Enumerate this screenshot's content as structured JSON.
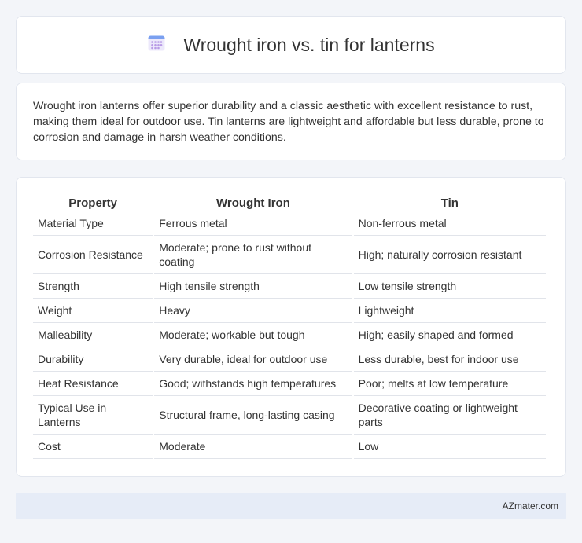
{
  "header": {
    "title": "Wrought iron vs. tin for lanterns",
    "icon": "calendar-icon"
  },
  "summary": {
    "text": "Wrought iron lanterns offer superior durability and a classic aesthetic with excellent resistance to rust, making them ideal for outdoor use. Tin lanterns are lightweight and affordable but less durable, prone to corrosion and damage in harsh weather conditions."
  },
  "table": {
    "headers": [
      "Property",
      "Wrought Iron",
      "Tin"
    ],
    "rows": [
      [
        "Material Type",
        "Ferrous metal",
        "Non-ferrous metal"
      ],
      [
        "Corrosion Resistance",
        "Moderate; prone to rust without coating",
        "High; naturally corrosion resistant"
      ],
      [
        "Strength",
        "High tensile strength",
        "Low tensile strength"
      ],
      [
        "Weight",
        "Heavy",
        "Lightweight"
      ],
      [
        "Malleability",
        "Moderate; workable but tough",
        "High; easily shaped and formed"
      ],
      [
        "Durability",
        "Very durable, ideal for outdoor use",
        "Less durable, best for indoor use"
      ],
      [
        "Heat Resistance",
        "Good; withstands high temperatures",
        "Poor; melts at low temperature"
      ],
      [
        "Typical Use in Lanterns",
        "Structural frame, long-lasting casing",
        "Decorative coating or lightweight parts"
      ],
      [
        "Cost",
        "Moderate",
        "Low"
      ]
    ]
  },
  "footer": {
    "text": "AZmater.com"
  },
  "colors": {
    "background": "#f3f5f9",
    "card": "#ffffff",
    "footer_bg": "#e6ecf7",
    "icon_top": "#7b9ff0",
    "icon_body": "#e9e4fb",
    "icon_dots": "#b59be8"
  }
}
